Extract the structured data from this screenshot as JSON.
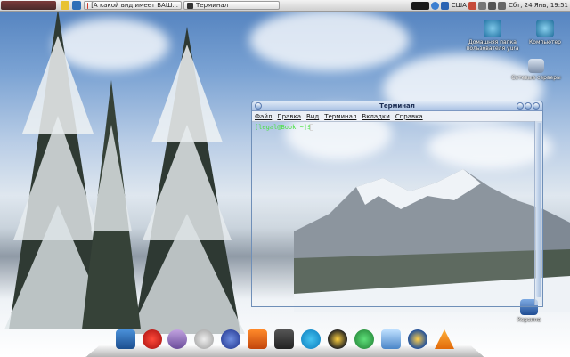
{
  "top_panel": {
    "tasks": [
      {
        "label": "[А какой вид имеет ВАШ..."
      },
      {
        "label": "Терминал"
      }
    ],
    "keyboard_layout": "США",
    "clock": "Сбт, 24 Янв, 19:51"
  },
  "desktop_icons": [
    {
      "label": "Домашняя папка пользователя yura"
    },
    {
      "label": "Компьютер"
    },
    {
      "label": "Сетевые серверы"
    },
    {
      "label": "Корзина"
    }
  ],
  "terminal": {
    "title": "Терминал",
    "menu": [
      "Файл",
      "Правка",
      "Вид",
      "Терминал",
      "Вкладки",
      "Справка"
    ],
    "prompt": "[legal@Book ~]$"
  },
  "dock": {
    "icons": [
      "file-manager-icon",
      "opera-icon",
      "pidgin-icon",
      "sound-icon",
      "globe-icon",
      "recorder-icon",
      "monitor-icon",
      "skype-icon",
      "penguin-icon",
      "network-icon",
      "virtualbox-icon",
      "thunderbird-icon",
      "vlc-icon"
    ]
  },
  "colors": {
    "prompt": "#49e043",
    "title_bar": "#a9c1e3"
  }
}
